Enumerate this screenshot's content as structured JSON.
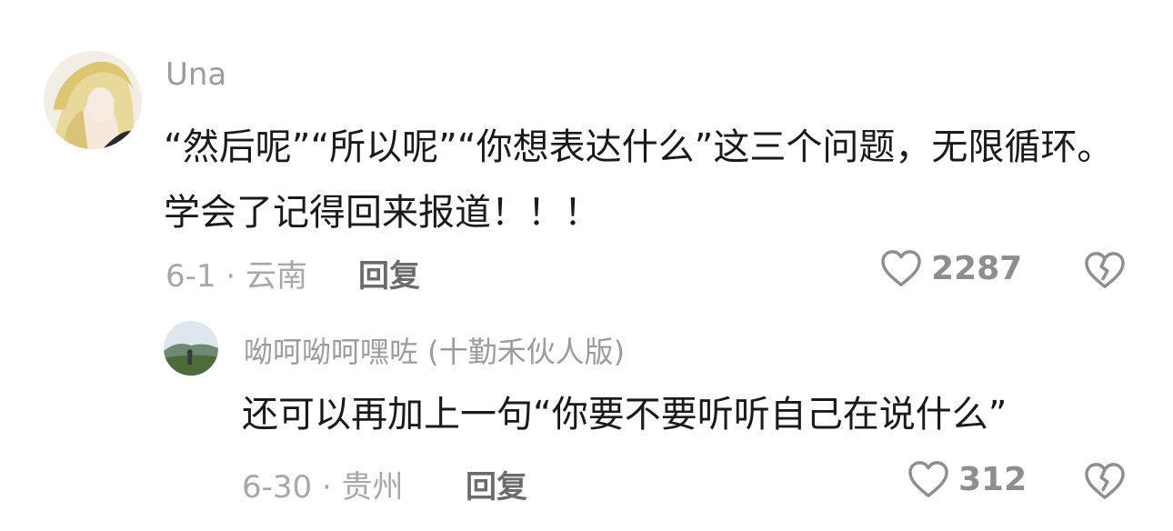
{
  "comments": [
    {
      "username": "Una",
      "text": "“然后呢”“所以呢”“你想表达什么”这三个问题，无限循环。学会了记得回来报道！！！",
      "date": "6-1",
      "location": "云南",
      "reply_label": "回复",
      "likes": "2287",
      "like_icon": "heart-outline-icon",
      "dislike_icon": "broken-heart-icon"
    },
    {
      "username": "呦呵呦呵嘿咗 (十勤禾伙人版)",
      "text": "还可以再加上一句“你要不要听听自己在说什么”",
      "date": "6-30",
      "location": "贵州",
      "reply_label": "回复",
      "likes": "312",
      "like_icon": "heart-outline-icon",
      "dislike_icon": "broken-heart-icon"
    }
  ],
  "colors": {
    "username": "#9c9c9c",
    "text": "#1a1a1a",
    "meta": "#a8a8a8",
    "icon": "#8e8e8e"
  }
}
